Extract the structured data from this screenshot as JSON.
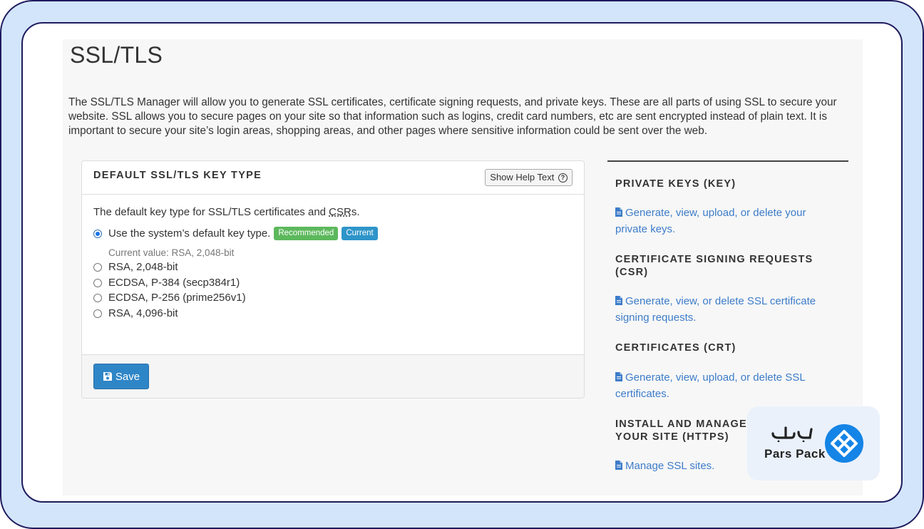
{
  "page": {
    "title": "SSL/TLS",
    "intro": "The SSL/TLS Manager will allow you to generate SSL certificates, certificate signing requests, and private keys. These are all parts of using SSL to secure your website. SSL allows you to secure pages on your site so that information such as logins, credit card numbers, etc are sent encrypted instead of plain text. It is important to secure your site’s login areas, shopping areas, and other pages where sensitive information could be sent over the web."
  },
  "card": {
    "title": "DEFAULT SSL/TLS KEY TYPE",
    "help_button": "Show Help Text",
    "description_prefix": "The default key type for SSL/TLS certificates and ",
    "description_abbr": "CSR",
    "description_suffix": "s.",
    "options": [
      {
        "label": "Use the system’s default key type.",
        "checked": true
      },
      {
        "label": "RSA, 2,048-bit",
        "checked": false
      },
      {
        "label": "ECDSA, P-384 (secp384r1)",
        "checked": false
      },
      {
        "label": "ECDSA, P-256 (prime256v1)",
        "checked": false
      },
      {
        "label": "RSA, 4,096-bit",
        "checked": false
      }
    ],
    "badge_recommended": "Recommended",
    "badge_current": "Current",
    "current_value": "Current value: RSA, 2,048-bit",
    "save_label": "Save"
  },
  "sidebar": {
    "sections": [
      {
        "heading": "PRIVATE KEYS (KEY)",
        "link": "Generate, view, upload, or delete your private keys."
      },
      {
        "heading": "CERTIFICATE SIGNING REQUESTS (CSR)",
        "link": "Generate, view, or delete SSL certificate signing requests."
      },
      {
        "heading": "CERTIFICATES (CRT)",
        "link": "Generate, view, upload, or delete SSL certificates."
      },
      {
        "heading": "INSTALL AND MANAGE SSL FOR YOUR SITE (HTTPS)",
        "link": "Manage SSL sites."
      }
    ]
  },
  "logo": {
    "persian": "پارس پک",
    "english": "Pars Pack"
  },
  "colors": {
    "link": "#3d7cc9",
    "save": "#2f86c7",
    "badge_green": "#5cb85c",
    "badge_blue": "#2e95c9",
    "frame": "#1f1b5e",
    "outer_bg": "#d3e5fb"
  }
}
